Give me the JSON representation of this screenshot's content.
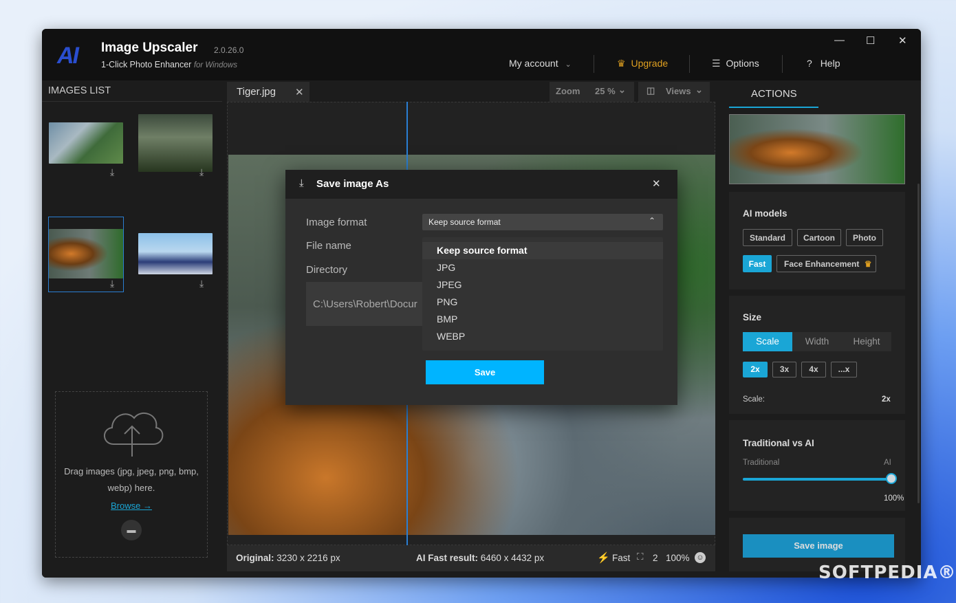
{
  "app": {
    "logo_text": "AI",
    "name": "Image Upscaler",
    "version": "2.0.26.0",
    "subtitle": "1-Click Photo Enhancer",
    "subtitle_suffix": "for Windows"
  },
  "nav": {
    "account": "My account",
    "upgrade": "Upgrade",
    "options": "Options",
    "help": "Help",
    "colors": {
      "upgrade": "#e0a020"
    }
  },
  "window_controls": {
    "minimize": "—",
    "maximize": "☐",
    "close": "✕"
  },
  "images_list": {
    "title": "IMAGES LIST",
    "items": [
      {
        "name": "building",
        "selected": false
      },
      {
        "name": "forest",
        "selected": false
      },
      {
        "name": "tiger",
        "selected": true
      },
      {
        "name": "anime",
        "selected": false
      }
    ],
    "drop_text": "Drag images (jpg, jpeg, png, bmp, webp) here.",
    "browse": "Browse →"
  },
  "viewer": {
    "tab_name": "Tiger.jpg",
    "zoom_label": "Zoom",
    "zoom_value": "25 %",
    "views_label": "Views",
    "original_label": "Original:",
    "original_value": "3230 x 2216 px",
    "result_label": "AI Fast result:",
    "result_value": "6460 x 4432 px",
    "mode": "Fast",
    "scale": "2",
    "zoom_pct": "100%"
  },
  "actions": {
    "title": "ACTIONS",
    "ai_models_title": "AI models",
    "models": [
      "Standard",
      "Cartoon",
      "Photo",
      "Fast",
      "Face Enhancement"
    ],
    "active_model": "Fast",
    "size_title": "Size",
    "size_tabs": [
      "Scale",
      "Width",
      "Height"
    ],
    "scale_options": [
      "2x",
      "3x",
      "4x",
      "...x"
    ],
    "scale_label": "Scale:",
    "scale_value": "2x",
    "trad_title": "Traditional vs AI",
    "trad_left": "Traditional",
    "trad_right": "AI",
    "trad_value": "100%",
    "trad_level": 1.0,
    "save_button": "Save image",
    "colors": {
      "accent": "#1aa6d6"
    }
  },
  "dialog": {
    "title": "Save image As",
    "format_label": "Image format",
    "format_value": "Keep source format",
    "filename_label": "File name",
    "directory_label": "Directory",
    "directory_value": "C:\\Users\\Robert\\Docur",
    "options": [
      "Keep source format",
      "JPG",
      "JPEG",
      "PNG",
      "BMP",
      "WEBP"
    ],
    "save": "Save"
  },
  "watermark": "SOFTPEDIA®"
}
